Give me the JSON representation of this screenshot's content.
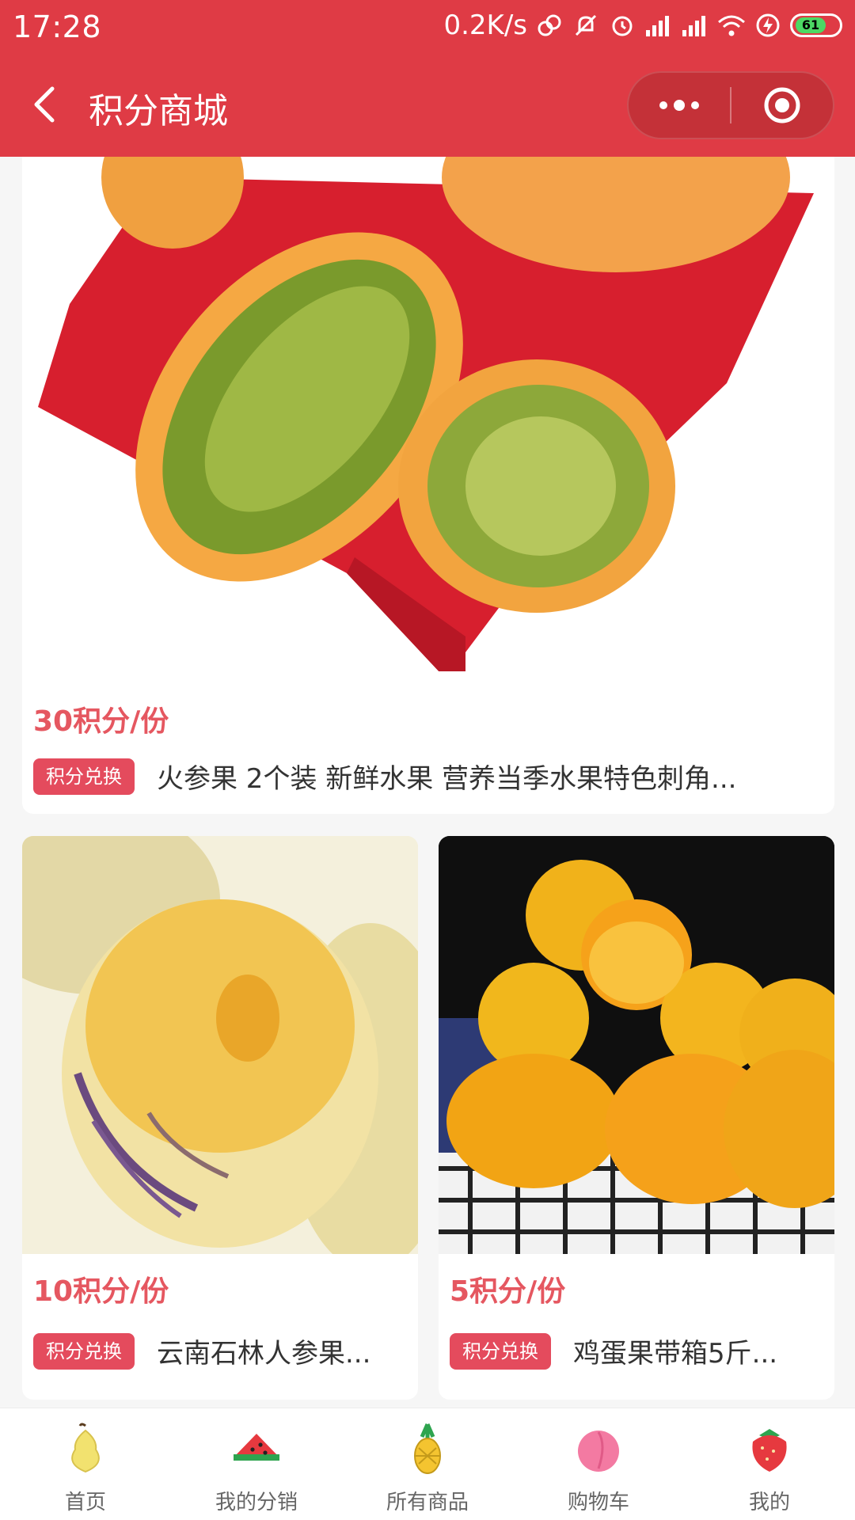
{
  "status_bar": {
    "time": "17:28",
    "net_speed": "0.2K/s",
    "battery": "61"
  },
  "nav": {
    "title": "积分商城"
  },
  "products": [
    {
      "points": "30积分/份",
      "tag": "积分兑换",
      "name": "火参果 2个装 新鲜水果 营养当季水果特色刺角..."
    },
    {
      "points": "10积分/份",
      "tag": "积分兑换",
      "name": "云南石林人参果..."
    },
    {
      "points": "5积分/份",
      "tag": "积分兑换",
      "name": "鸡蛋果带箱5斤..."
    }
  ],
  "tabs": [
    {
      "label": "首页",
      "icon": "pear-icon"
    },
    {
      "label": "我的分销",
      "icon": "watermelon-icon"
    },
    {
      "label": "所有商品",
      "icon": "pineapple-icon"
    },
    {
      "label": "购物车",
      "icon": "peach-icon"
    },
    {
      "label": "我的",
      "icon": "strawberry-icon"
    }
  ],
  "colors": {
    "brand_red": "#df3b45",
    "price_red": "#e55760",
    "tag_red": "#e44b5d"
  }
}
